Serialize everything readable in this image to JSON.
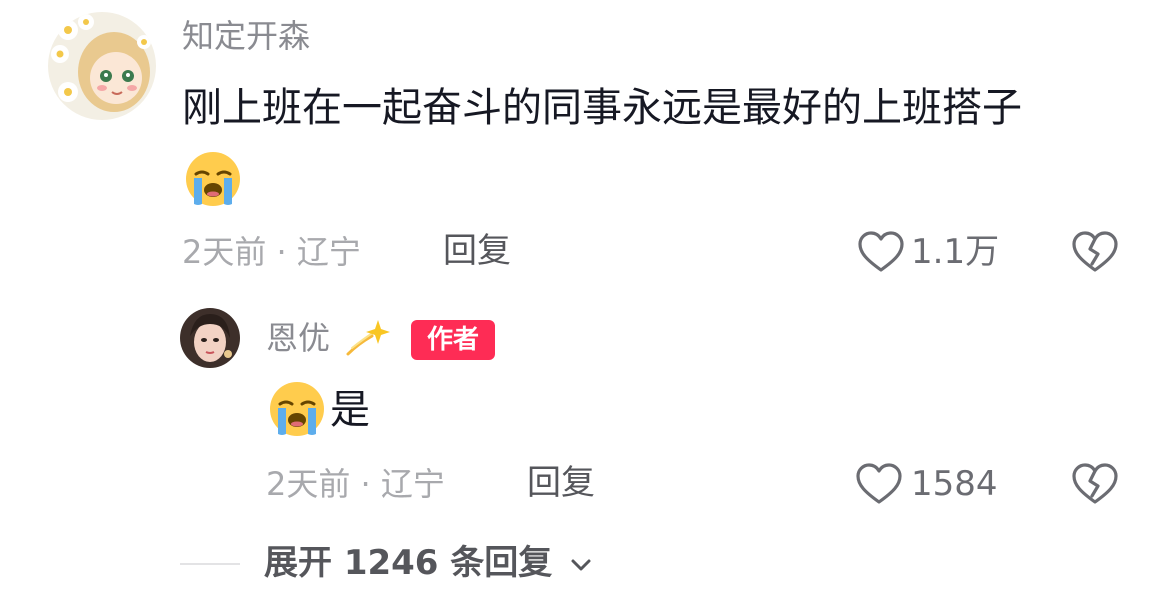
{
  "comment": {
    "username": "知定开森",
    "text": "刚上班在一起奋斗的同事永远是最好的上班搭子",
    "emoji_icon": "loudly-crying-face-icon",
    "meta": "2天前 · 辽宁",
    "reply_label": "回复",
    "like_count": "1.1万"
  },
  "reply": {
    "username": "恩优",
    "name_emoji_icon": "dizzy-sparkle-icon",
    "badge": "作者",
    "emoji_icon": "loudly-crying-face-icon",
    "text": "是",
    "meta": "2天前 · 辽宁",
    "reply_label": "回复",
    "like_count": "1584"
  },
  "expand": {
    "label": "展开 1246 条回复"
  },
  "colors": {
    "badge_bg": "#fe2c55",
    "muted_text": "#a8a9ad",
    "username_text": "#8a8b91",
    "primary_text": "#161823"
  }
}
